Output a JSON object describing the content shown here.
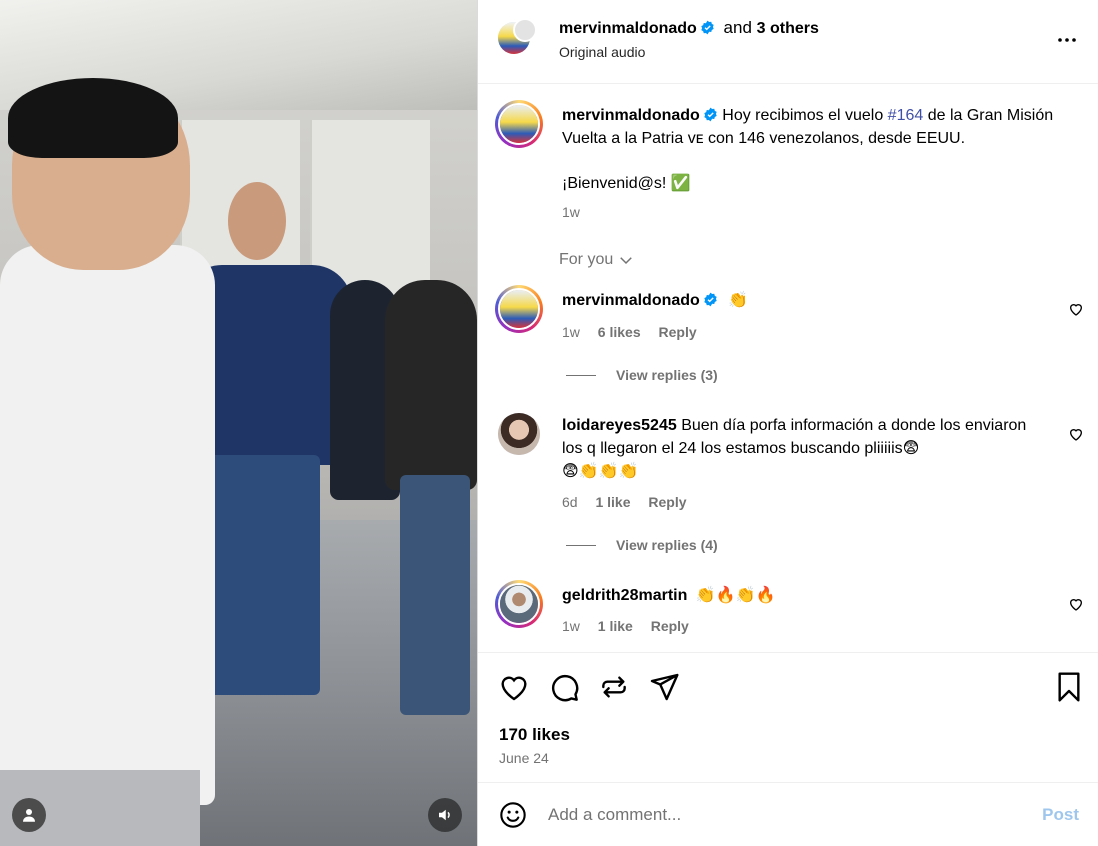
{
  "header": {
    "username": "mervinmaldonado",
    "and_text": "and",
    "others": "3 others",
    "subtitle": "Original audio"
  },
  "caption": {
    "username": "mervinmaldonado",
    "text_before": "Hoy recibimos el vuelo",
    "hashtag": "#164",
    "text_after": "de la Gran Misión Vuelta a la Patria ᴠᴇ con 146 venezolanos, desde EEUU.",
    "welcome": "¡Bienvenid@s! ✅",
    "time": "1w"
  },
  "for_you": "For you",
  "comments": [
    {
      "username": "mervinmaldonado",
      "text": "👏",
      "time": "1w",
      "likes": "6 likes",
      "reply": "Reply"
    },
    {
      "username": "loidareyes5245",
      "text": "Buen día porfa información a donde los enviaron los q llegaron el 24 los estamos buscando pliiiiis😨",
      "text2": "😨👏👏👏",
      "time": "6d",
      "likes": "1 like",
      "reply": "Reply"
    },
    {
      "username": "geldrith28martin",
      "text": "👏🔥👏🔥",
      "time": "1w",
      "likes": "1 like",
      "reply": "Reply"
    }
  ],
  "view_replies": [
    "View replies (3)",
    "View replies (4)"
  ],
  "likes": "170 likes",
  "date": "June 24",
  "add_comment": {
    "placeholder": "Add a comment...",
    "post": "Post"
  },
  "colors": {
    "hashtag": "#4150a7",
    "verified": "#0095f6",
    "post_disabled": "#9fc7ee"
  }
}
